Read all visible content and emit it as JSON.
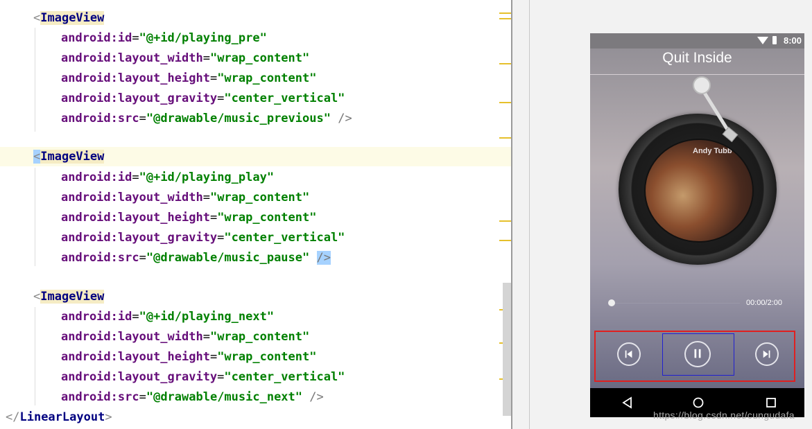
{
  "code": {
    "block1": {
      "tag": "ImageView",
      "id_attr": "android:id",
      "id_val": "\"@+id/playing_pre\"",
      "w_attr": "android:layout_width",
      "w_val": "\"wrap_content\"",
      "h_attr": "android:layout_height",
      "h_val": "\"wrap_content\"",
      "g_attr": "android:layout_gravity",
      "g_val": "\"center_vertical\"",
      "src_attr": "android:src",
      "src_val": "\"@drawable/music_previous\"",
      "close": "/>"
    },
    "block2": {
      "tag": "ImageView",
      "id_attr": "android:id",
      "id_val": "\"@+id/playing_play\"",
      "w_attr": "android:layout_width",
      "w_val": "\"wrap_content\"",
      "h_attr": "android:layout_height",
      "h_val": "\"wrap_content\"",
      "g_attr": "android:layout_gravity",
      "g_val": "\"center_vertical\"",
      "src_attr": "android:src",
      "src_val": "\"@drawable/music_pause\"",
      "close": "/>"
    },
    "block3": {
      "tag": "ImageView",
      "id_attr": "android:id",
      "id_val": "\"@+id/playing_next\"",
      "w_attr": "android:layout_width",
      "w_val": "\"wrap_content\"",
      "h_attr": "android:layout_height",
      "h_val": "\"wrap_content\"",
      "g_attr": "android:layout_gravity",
      "g_val": "\"center_vertical\"",
      "src_attr": "android:src",
      "src_val": "\"@drawable/music_next\"",
      "close": "/>"
    },
    "closing_tag": "LinearLayout"
  },
  "preview": {
    "status_time": "8:00",
    "title": "Quit Inside",
    "cover_text": "Andy Tubb",
    "time": "00:00/2:00",
    "icons": {
      "prev": "skip-previous-icon",
      "play": "pause-icon",
      "next": "skip-next-icon",
      "back": "back-triangle-icon",
      "home": "home-circle-icon",
      "recents": "recents-square-icon"
    },
    "colors": {
      "selection_outline": "#e02020",
      "component_outline": "#2020d0",
      "code_attribute": "#660e7a",
      "code_value": "#008000",
      "code_tag": "#000080"
    }
  },
  "watermark": "https://blog.csdn.net/cungudafa"
}
